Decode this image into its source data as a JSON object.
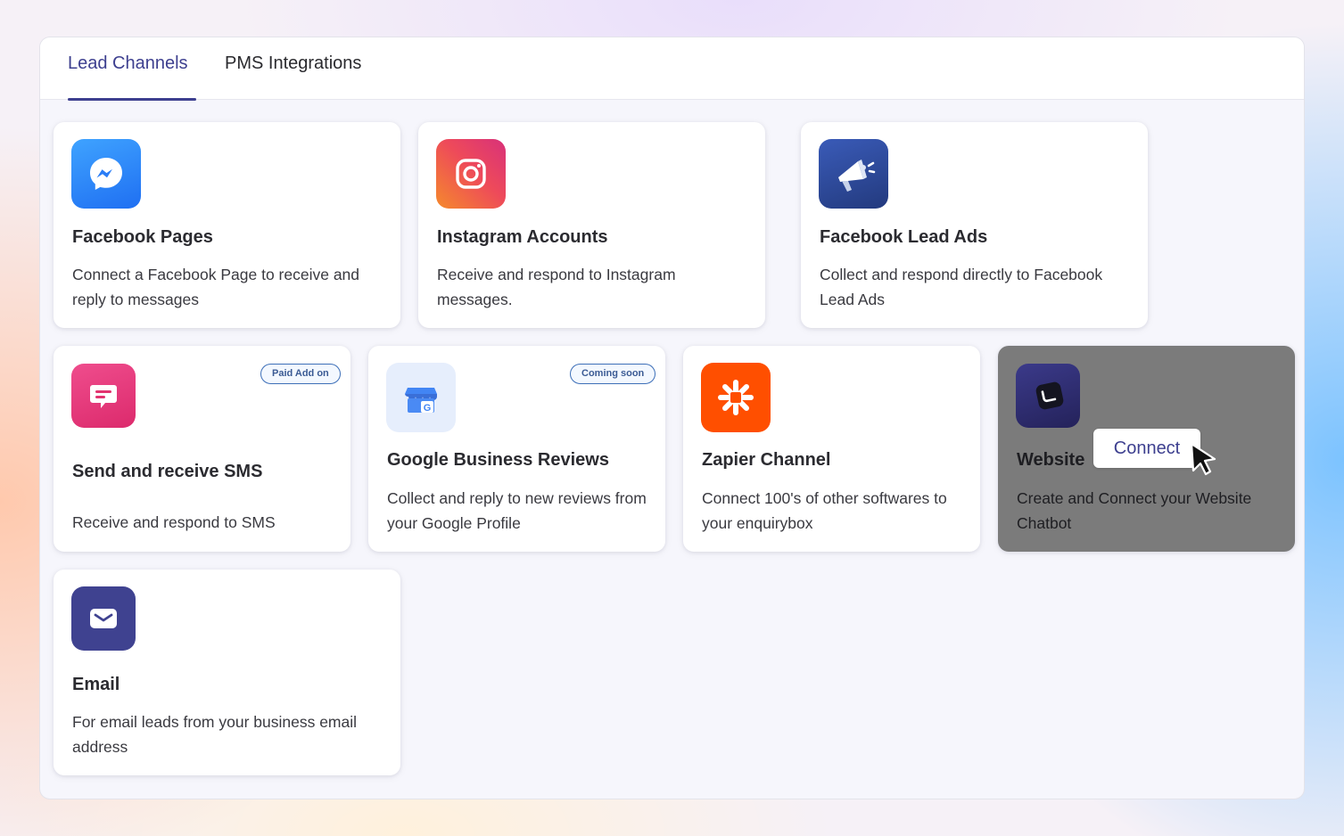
{
  "tabs": [
    {
      "label": "Lead Channels",
      "active": true
    },
    {
      "label": "PMS Integrations",
      "active": false
    }
  ],
  "channels": [
    {
      "title": "Facebook Pages",
      "description": "Connect a Facebook Page to receive and reply to messages",
      "icon": "messenger-icon",
      "color": "#2d7ff9"
    },
    {
      "title": "Instagram Accounts",
      "description": "Receive and respond to Instagram messages.",
      "icon": "instagram-icon",
      "color": "#e8456b"
    },
    {
      "title": "Facebook Lead Ads",
      "description": "Collect and respond directly to Facebook Lead Ads",
      "icon": "megaphone-icon",
      "color": "#2f4a9a"
    },
    {
      "title": "Send and receive SMS",
      "description": "Receive and respond to SMS",
      "icon": "sms-chat-icon",
      "color": "#e73b7d",
      "badge": "Paid Add on"
    },
    {
      "title": "Google Business Reviews",
      "description": "Collect and reply to new reviews from your Google Profile",
      "icon": "google-business-icon",
      "color": "#4285f4",
      "badge": "Coming soon"
    },
    {
      "title": "Zapier Channel",
      "description": "Connect 100's of other softwares to your enquirybox",
      "icon": "zapier-icon",
      "color": "#ff4f00"
    },
    {
      "title": "Website",
      "description": "Create and Connect your Website Chatbot",
      "icon": "chatbot-icon",
      "color": "#2f2d6e",
      "hovered": true
    },
    {
      "title": "Email",
      "description": "For email leads from your business email address",
      "icon": "envelope-icon",
      "color": "#3f4290"
    }
  ],
  "hover_action": {
    "label": "Connect"
  }
}
